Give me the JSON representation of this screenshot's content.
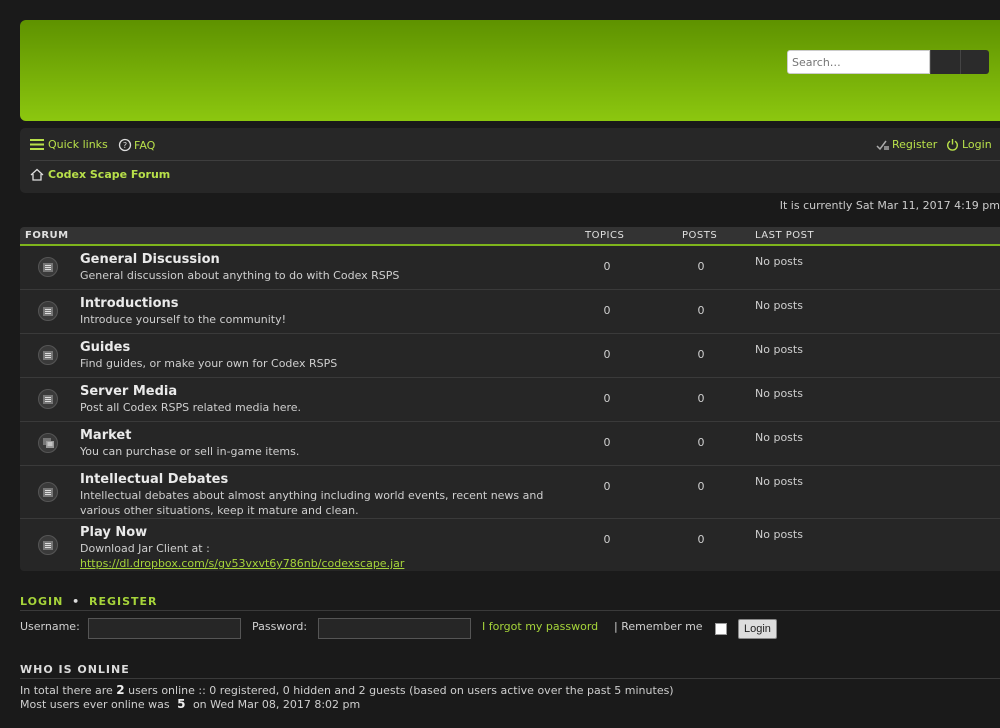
{
  "header": {
    "search_placeholder": "Search…"
  },
  "nav": {
    "quick_links": "Quick links",
    "faq": "FAQ",
    "register": "Register",
    "login": "Login",
    "breadcrumb": "Codex Scape Forum"
  },
  "current_time": "It is currently Sat Mar 11, 2017 4:19 pm",
  "table": {
    "col_forum": "FORUM",
    "col_topics": "TOPICS",
    "col_posts": "POSTS",
    "col_last_post": "LAST POST"
  },
  "forums": [
    {
      "title": "General Discussion",
      "desc": "General discussion about anything to do with Codex RSPS",
      "topics": "0",
      "posts": "0",
      "last_post": "No posts"
    },
    {
      "title": "Introductions",
      "desc": "Introduce yourself to the community!",
      "topics": "0",
      "posts": "0",
      "last_post": "No posts"
    },
    {
      "title": "Guides",
      "desc": "Find guides, or make your own for Codex RSPS",
      "topics": "0",
      "posts": "0",
      "last_post": "No posts"
    },
    {
      "title": "Server Media",
      "desc": "Post all Codex RSPS related media here.",
      "topics": "0",
      "posts": "0",
      "last_post": "No posts"
    },
    {
      "title": "Market",
      "desc": "You can purchase or sell in-game items.",
      "topics": "0",
      "posts": "0",
      "last_post": "No posts"
    },
    {
      "title": "Intellectual Debates",
      "desc": "Intellectual debates about almost anything including world events, recent news and various other situations, keep it mature and clean.",
      "topics": "0",
      "posts": "0",
      "last_post": "No posts"
    },
    {
      "title": "Play Now",
      "desc": "Download Jar Client at :",
      "link": "https://dl.dropbox.com/s/gv53vxvt6y786nb/codexscape.jar",
      "topics": "0",
      "posts": "0",
      "last_post": "No posts"
    }
  ],
  "login_section": {
    "title_login": "LOGIN",
    "title_register": "REGISTER",
    "username_label": "Username:",
    "password_label": "Password:",
    "forgot": "I forgot my password",
    "remember": "| Remember me",
    "button": "Login"
  },
  "online": {
    "title": "WHO IS ONLINE",
    "line1_pre": "In total there are",
    "line1_count": "2",
    "line1_post": "users online :: 0 registered, 0 hidden and 2 guests (based on users active over the past 5 minutes)",
    "line2_pre": "Most users ever online was",
    "line2_count": "5",
    "line2_post": "on Wed Mar 08, 2017 8:02 pm"
  }
}
